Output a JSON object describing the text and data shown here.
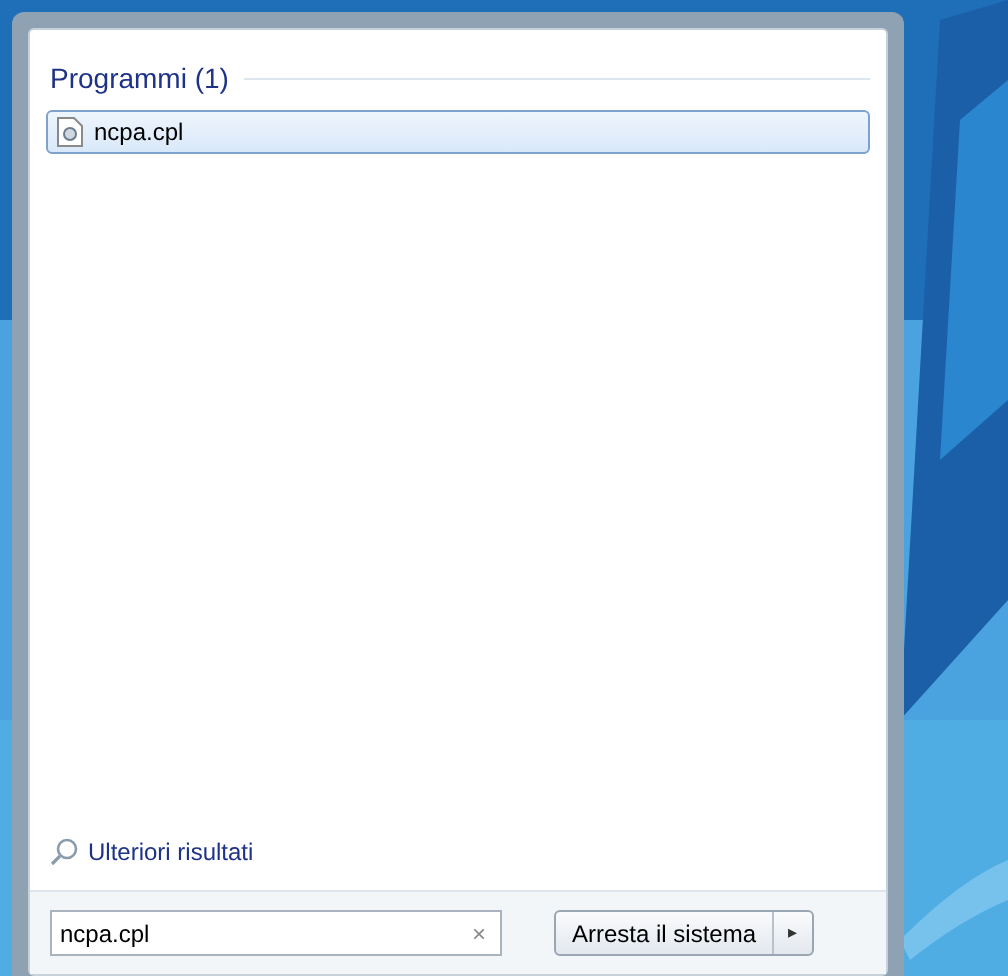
{
  "results": {
    "heading": "Programmi (1)",
    "items": [
      {
        "label": "ncpa.cpl",
        "selected": true
      }
    ]
  },
  "more_results": {
    "label": "Ulteriori risultati"
  },
  "search": {
    "value": "ncpa.cpl",
    "clear": "×"
  },
  "shutdown": {
    "label": "Arresta il sistema",
    "arrow": "▸"
  }
}
